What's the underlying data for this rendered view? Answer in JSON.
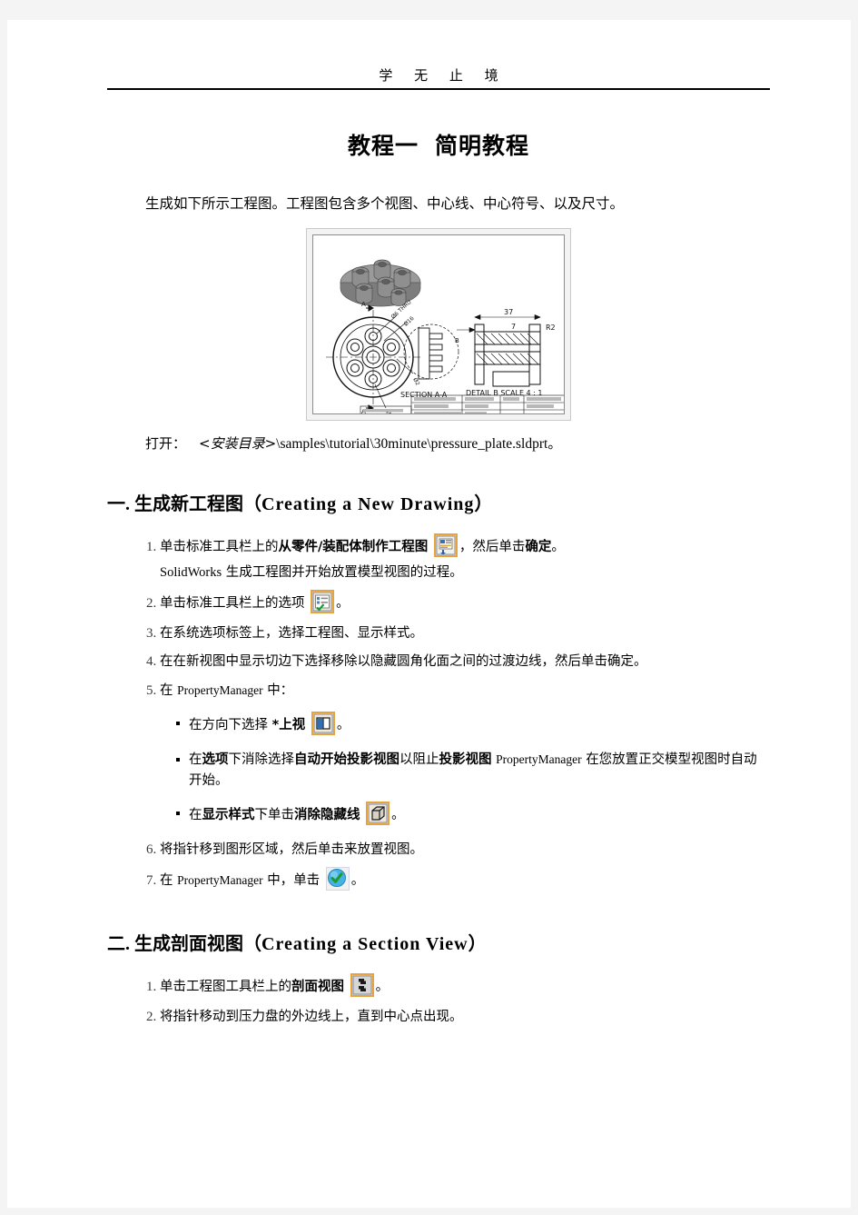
{
  "header": {
    "running_text": "学 无 止 境"
  },
  "title": {
    "prefix": "教程一",
    "main": "简明教程"
  },
  "intro": {
    "paragraph": "生成如下所示工程图。工程图包含多个视图、中心线、中心符号、以及尺寸。"
  },
  "figure": {
    "caption_label": "打开：",
    "path_angle": "<安装目录>",
    "path_rest": "\\samples\\tutorial\\30minute\\pressure_plate.sldprt",
    "path_end": "。",
    "alt": "SolidWorks pressure plate engineering drawing with isometric view, section A-A, and detail B scale 4:1",
    "drawing_labels": {
      "section": "SECTION A-A",
      "detail": "DETAIL B SCALE 4 : 1",
      "dim_37": "37",
      "dim_7": "7",
      "dim_r2": "R2",
      "mark_a_top": "A",
      "mark_a_bottom": "A",
      "mark_b": "B",
      "thru": "THRU"
    }
  },
  "sections": [
    {
      "number": "一.",
      "cn": "生成新工程图",
      "open_paren": "（",
      "en": "Creating  a  New  Drawing",
      "close_paren": "）"
    },
    {
      "number": "二.",
      "cn": "生成剖面视图",
      "open_paren": "（",
      "en": "Creating  a  Section  View",
      "close_paren": "）"
    }
  ],
  "section1_steps": {
    "s1_a": "单击标准工具栏上的",
    "s1_b": "从零件/装配体制作工程图",
    "s1_c": "，然后单击",
    "s1_d": "确定",
    "s1_e": "。",
    "s1_note_sw": "SolidWorks",
    "s1_note_cn": "生成工程图并开始放置模型视图的过程。",
    "s2_a": "单击标准工具栏上的选项",
    "s2_b": "。",
    "s3": "在系统选项标签上，选择工程图、显示样式。",
    "s4": "在在新视图中显示切边下选择移除以隐藏圆角化面之间的过渡边线，然后单击确定。",
    "s5_a": "在",
    "s5_pm": "PropertyManager",
    "s5_b": "中：",
    "b1_a": "在方向下选择 ",
    "b1_b": "*上视",
    "b1_c": "。",
    "b2_a": "在",
    "b2_b": "选项",
    "b2_c": "下消除选择",
    "b2_d": "自动开始投影视图",
    "b2_e": "以阻止",
    "b2_f": "投影视图",
    "b2_pm": "PropertyManager",
    "b2_g": "在您放置正交模型视图时自动开始。",
    "b3_a": "在",
    "b3_b": "显示样式",
    "b3_c": "下单击",
    "b3_d": "消除隐藏线",
    "b3_e": "。",
    "s6": "将指针移到图形区域，然后单击来放置视图。",
    "s7_a": "在",
    "s7_pm": "PropertyManager",
    "s7_b": "中，单击",
    "s7_c": "。"
  },
  "section2_steps": {
    "s1_a": "单击工程图工具栏上的",
    "s1_b": "剖面视图",
    "s1_c": "。",
    "s2": "将指针移动到压力盘的外边线上，直到中心点出现。"
  },
  "icons": {
    "make_drawing": "make-drawing-from-part-icon",
    "options": "options-icon",
    "top_view": "top-view-icon",
    "hidden_lines_removed": "hidden-lines-removed-icon",
    "ok_check": "ok-check-icon",
    "section_view": "section-view-icon"
  },
  "colors": {
    "icon_border": "#e8a33d",
    "icon_bg": "#d9e3ef",
    "page_bg": "#ffffff",
    "canvas_bg": "#f4f4f4",
    "ok_blue": "#45b3e7",
    "ok_green": "#1f9a2e"
  }
}
